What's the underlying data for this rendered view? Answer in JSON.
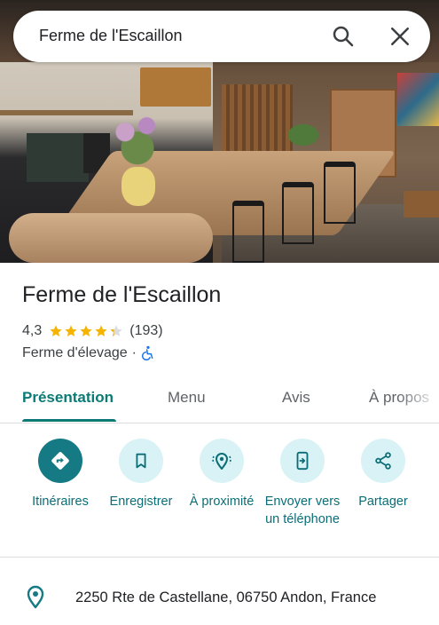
{
  "search": {
    "query": "Ferme de l'Escaillon"
  },
  "place": {
    "name": "Ferme de l'Escaillon",
    "rating": "4,3",
    "rating_value": 4.3,
    "review_count": "(193)",
    "category": "Ferme d'élevage",
    "separator": "·"
  },
  "tabs": [
    {
      "label": "Présentation",
      "active": true
    },
    {
      "label": "Menu",
      "active": false
    },
    {
      "label": "Avis",
      "active": false
    },
    {
      "label": "À propos",
      "active": false
    }
  ],
  "actions": [
    {
      "label": "Itinéraires",
      "icon": "directions-icon"
    },
    {
      "label": "Enregistrer",
      "icon": "bookmark-icon"
    },
    {
      "label": "À proximité",
      "icon": "nearby-icon"
    },
    {
      "label": "Envoyer vers un téléphone",
      "icon": "send-to-phone-icon"
    },
    {
      "label": "Partager",
      "icon": "share-icon"
    }
  ],
  "address": "2250 Rte de Castellane, 06750 Andon, France",
  "colors": {
    "accent": "#0b7a75",
    "action_bg": "#d8f2f5",
    "primary_action_bg": "#167a85",
    "star": "#f4b400"
  }
}
